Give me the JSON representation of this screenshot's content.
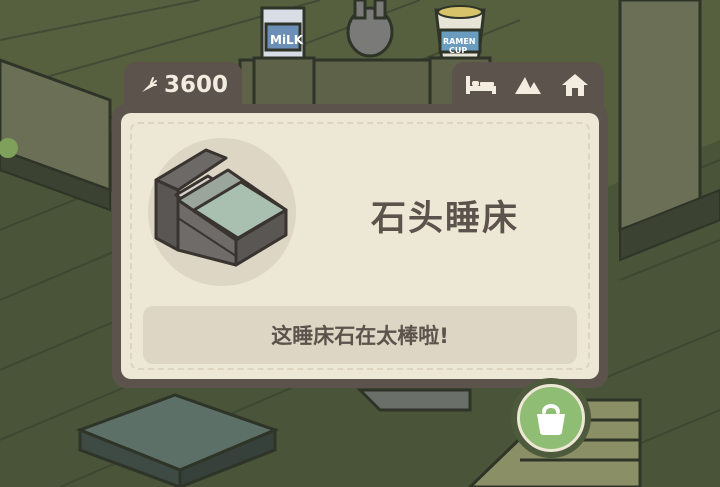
{
  "currency": {
    "amount": "3600",
    "icon": "carrot-icon"
  },
  "category_tabs": [
    {
      "icon": "bed-icon",
      "label": "bed"
    },
    {
      "icon": "mountain-icon",
      "label": "outdoor"
    },
    {
      "icon": "house-icon",
      "label": "home"
    }
  ],
  "item": {
    "name": "石头睡床",
    "description": "这睡床石在太棒啦!",
    "image": "stone-bed-image"
  },
  "buy_button": {
    "icon": "shopping-bag-icon"
  },
  "colors": {
    "panel": "#5b534c",
    "card": "#ede7d6",
    "accent_green": "#8fbd73"
  }
}
